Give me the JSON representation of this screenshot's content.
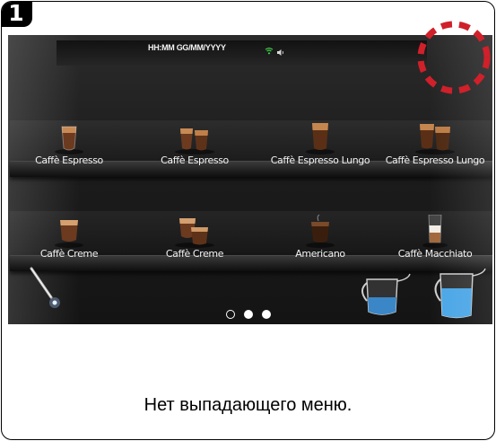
{
  "step": {
    "number": "1"
  },
  "status_bar": {
    "datetime": "HH:MM GG/MM/YYYY"
  },
  "drinks": [
    {
      "label": "Caffè Espresso"
    },
    {
      "label": "Caffè Espresso"
    },
    {
      "label": "Caffè Espresso Lungo"
    },
    {
      "label": "Caffè Espresso Lungo"
    },
    {
      "label": "Caffè Creme"
    },
    {
      "label": "Caffè Creme"
    },
    {
      "label": "Americano"
    },
    {
      "label": "Caffè Macchiato"
    }
  ],
  "pagination": {
    "pages": 3,
    "current": 1
  },
  "caption": "Нет выпадающего меню.",
  "colors": {
    "highlight": "#d0202a",
    "wifi": "#3fd14a",
    "screen_bg": "#1c1c1c",
    "milk_blue": "#4aa6e6"
  },
  "icons": [
    "wifi-icon",
    "speaker-icon",
    "steam-wand-icon",
    "milk-pitcher-icon"
  ]
}
